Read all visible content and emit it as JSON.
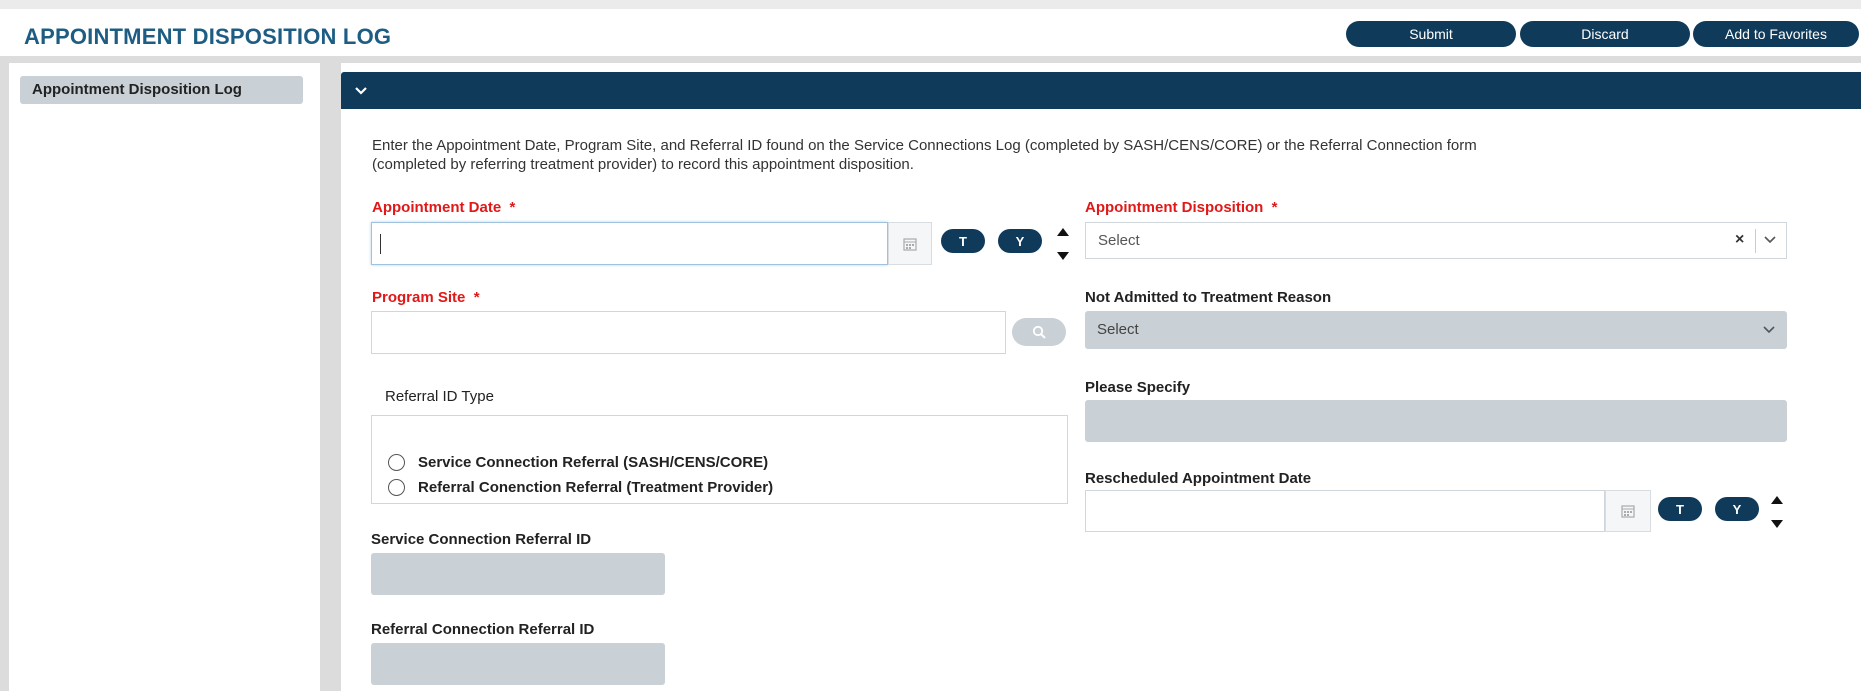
{
  "header": {
    "title": "APPOINTMENT DISPOSITION LOG",
    "buttons": {
      "submit": "Submit",
      "discard": "Discard",
      "favorites": "Add to Favorites"
    }
  },
  "sidebar": {
    "items": [
      {
        "label": "Appointment Disposition Log",
        "selected": true
      }
    ]
  },
  "section": {
    "intro_line1": "Enter the Appointment Date, Program Site, and Referral ID found on the Service Connections Log (completed by SASH/CENS/CORE) or the Referral Connection form",
    "intro_line2": "(completed by referring treatment provider) to record this appointment disposition."
  },
  "form": {
    "appointment_date": {
      "label": "Appointment Date",
      "required_mark": "*",
      "value": "",
      "btn_today": "T",
      "btn_yesterday": "Y"
    },
    "program_site": {
      "label": "Program Site",
      "required_mark": "*",
      "value": ""
    },
    "referral_id_type": {
      "label": "Referral ID Type",
      "options": [
        "Service Connection Referral (SASH/CENS/CORE)",
        "Referral Conenction Referral (Treatment Provider)"
      ]
    },
    "service_connection_referral_id": {
      "label": "Service Connection Referral ID"
    },
    "referral_connection_referral_id": {
      "label": "Referral Connection Referral ID"
    },
    "appointment_disposition": {
      "label": "Appointment Disposition",
      "required_mark": "*",
      "value": "Select"
    },
    "not_admitted_reason": {
      "label": "Not Admitted to Treatment Reason",
      "value": "Select"
    },
    "please_specify": {
      "label": "Please Specify"
    },
    "rescheduled_date": {
      "label": "Rescheduled Appointment Date",
      "btn_today": "T",
      "btn_yesterday": "Y"
    }
  },
  "colors": {
    "accent": "#0f3a5a",
    "title": "#1d5d83",
    "required": "#e01818",
    "disabled_field": "#c9d0d6"
  },
  "icons": [
    "chevron-down-icon",
    "calendar-icon",
    "search-icon",
    "clear-x-icon",
    "stepper-arrows-icon"
  ]
}
